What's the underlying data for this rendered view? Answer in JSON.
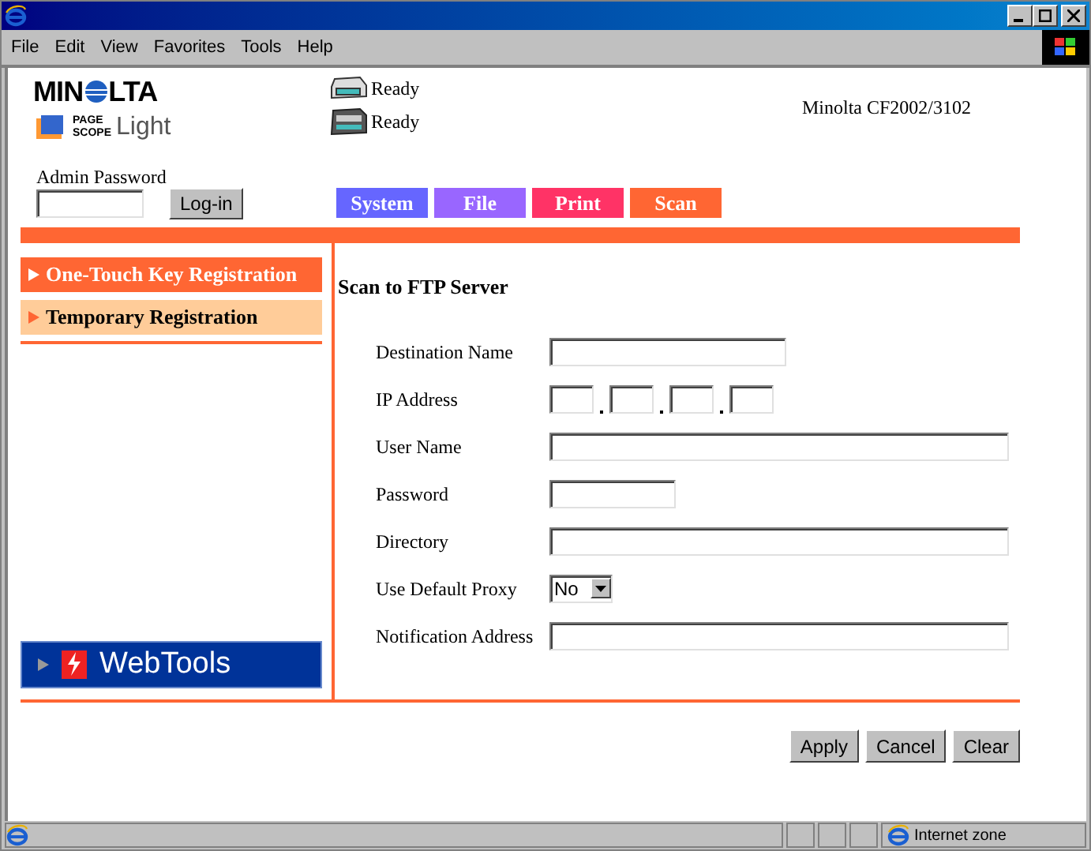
{
  "menu": [
    "File",
    "Edit",
    "View",
    "Favorites",
    "Tools",
    "Help"
  ],
  "header": {
    "brand_left": "MIN",
    "brand_right": "LTA",
    "product_top": "PAGE",
    "product_bottom": "SCOPE",
    "product_name": "Light",
    "statuses": [
      {
        "kind": "printer",
        "text": "Ready"
      },
      {
        "kind": "scanner",
        "text": "Ready"
      }
    ],
    "model": "Minolta CF2002/3102"
  },
  "admin": {
    "label": "Admin Password",
    "login": "Log-in"
  },
  "tabs": [
    {
      "label": "System",
      "color": "#6666ff"
    },
    {
      "label": "File",
      "color": "#9966ff"
    },
    {
      "label": "Print",
      "color": "#ff3366"
    },
    {
      "label": "Scan",
      "color": "#ff6633"
    }
  ],
  "sidebar": {
    "items": [
      {
        "label": "One-Touch Key Registration",
        "selected": false
      },
      {
        "label": "Temporary Registration",
        "selected": true
      }
    ],
    "webtools": "WebTools"
  },
  "form": {
    "title": "Scan to FTP Server",
    "fields": [
      {
        "label": "Destination Name",
        "kind": "text"
      },
      {
        "label": "IP Address",
        "kind": "ip"
      },
      {
        "label": "User Name",
        "kind": "text"
      },
      {
        "label": "Password",
        "kind": "text"
      },
      {
        "label": "Directory",
        "kind": "text"
      },
      {
        "label": "Use Default Proxy",
        "kind": "select",
        "value": "No"
      },
      {
        "label": "Notification Address",
        "kind": "text"
      }
    ]
  },
  "buttons": [
    "Apply",
    "Cancel",
    "Clear"
  ],
  "status_bar": {
    "zone": "Internet zone"
  }
}
